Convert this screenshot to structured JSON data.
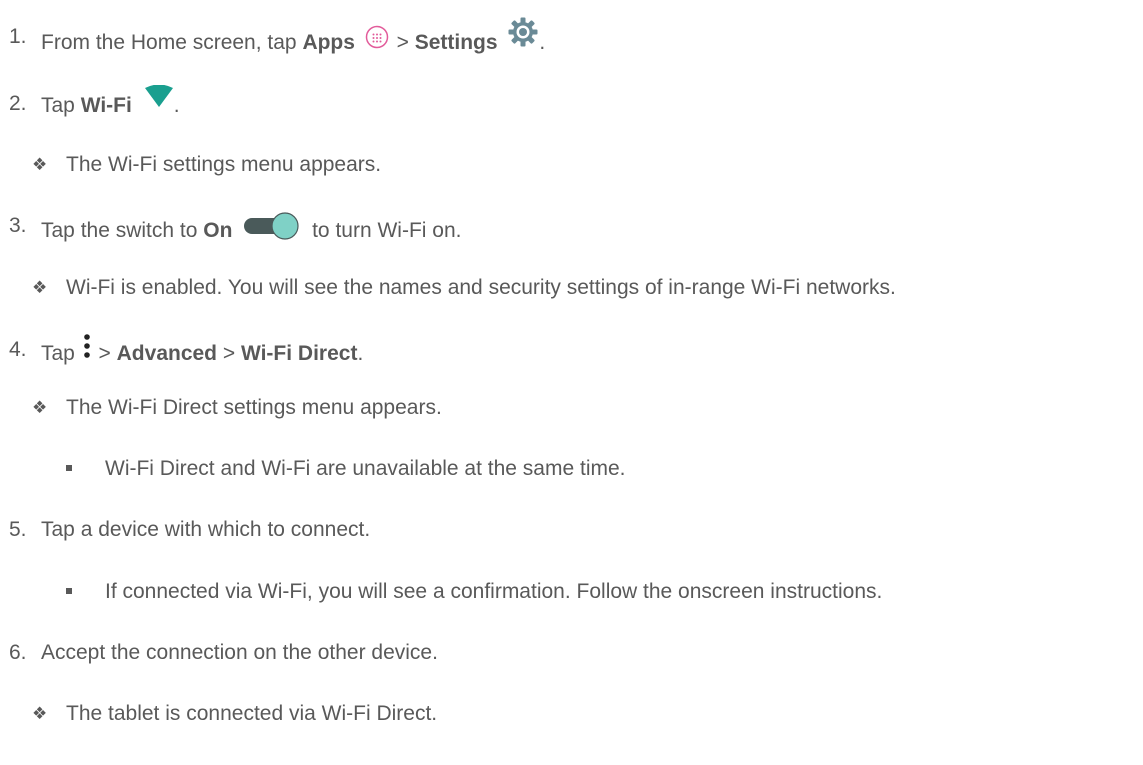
{
  "steps": [
    {
      "number": "1.",
      "parts": {
        "a": "From the Home screen, tap ",
        "b": "Apps",
        "c": " > ",
        "d": "Settings",
        "e": "."
      }
    },
    {
      "number": "2.",
      "parts": {
        "a": "Tap ",
        "b": "Wi-Fi",
        "c": "."
      },
      "note": "The Wi-Fi settings menu appears."
    },
    {
      "number": "3.",
      "parts": {
        "a": "Tap the switch to ",
        "b": "On",
        "c": " to turn Wi-Fi on."
      },
      "note": "Wi-Fi is enabled. You will see the names and security settings of in-range Wi-Fi networks."
    },
    {
      "number": "4.",
      "parts": {
        "a": "Tap ",
        "b": " > ",
        "c": "Advanced",
        "d": " > ",
        "e": "Wi-Fi Direct",
        "f": "."
      },
      "note": "The Wi-Fi Direct settings menu appears.",
      "subnote": "Wi-Fi Direct and Wi-Fi are unavailable at the same time."
    },
    {
      "number": "5.",
      "text": "Tap a device with which to connect.",
      "subnote": "If connected via Wi-Fi, you will see a confirmation. Follow the onscreen instructions."
    },
    {
      "number": "6.",
      "text": "Accept the connection on the other device.",
      "note": "The tablet is connected via Wi-Fi Direct."
    }
  ],
  "bullet_glyph": "❖",
  "icons": {
    "apps": "apps-icon",
    "settings": "gear-icon",
    "wifi": "wifi-icon",
    "toggle": "toggle-switch-icon",
    "menu": "more-vert-icon"
  },
  "colors": {
    "text": "#595959",
    "accent_teal": "#1a9f8f",
    "apps_pink": "#e25b9a",
    "toggle_track": "#4a5a5a",
    "toggle_knob": "#7fd1c6",
    "gear": "#6a8a96"
  }
}
